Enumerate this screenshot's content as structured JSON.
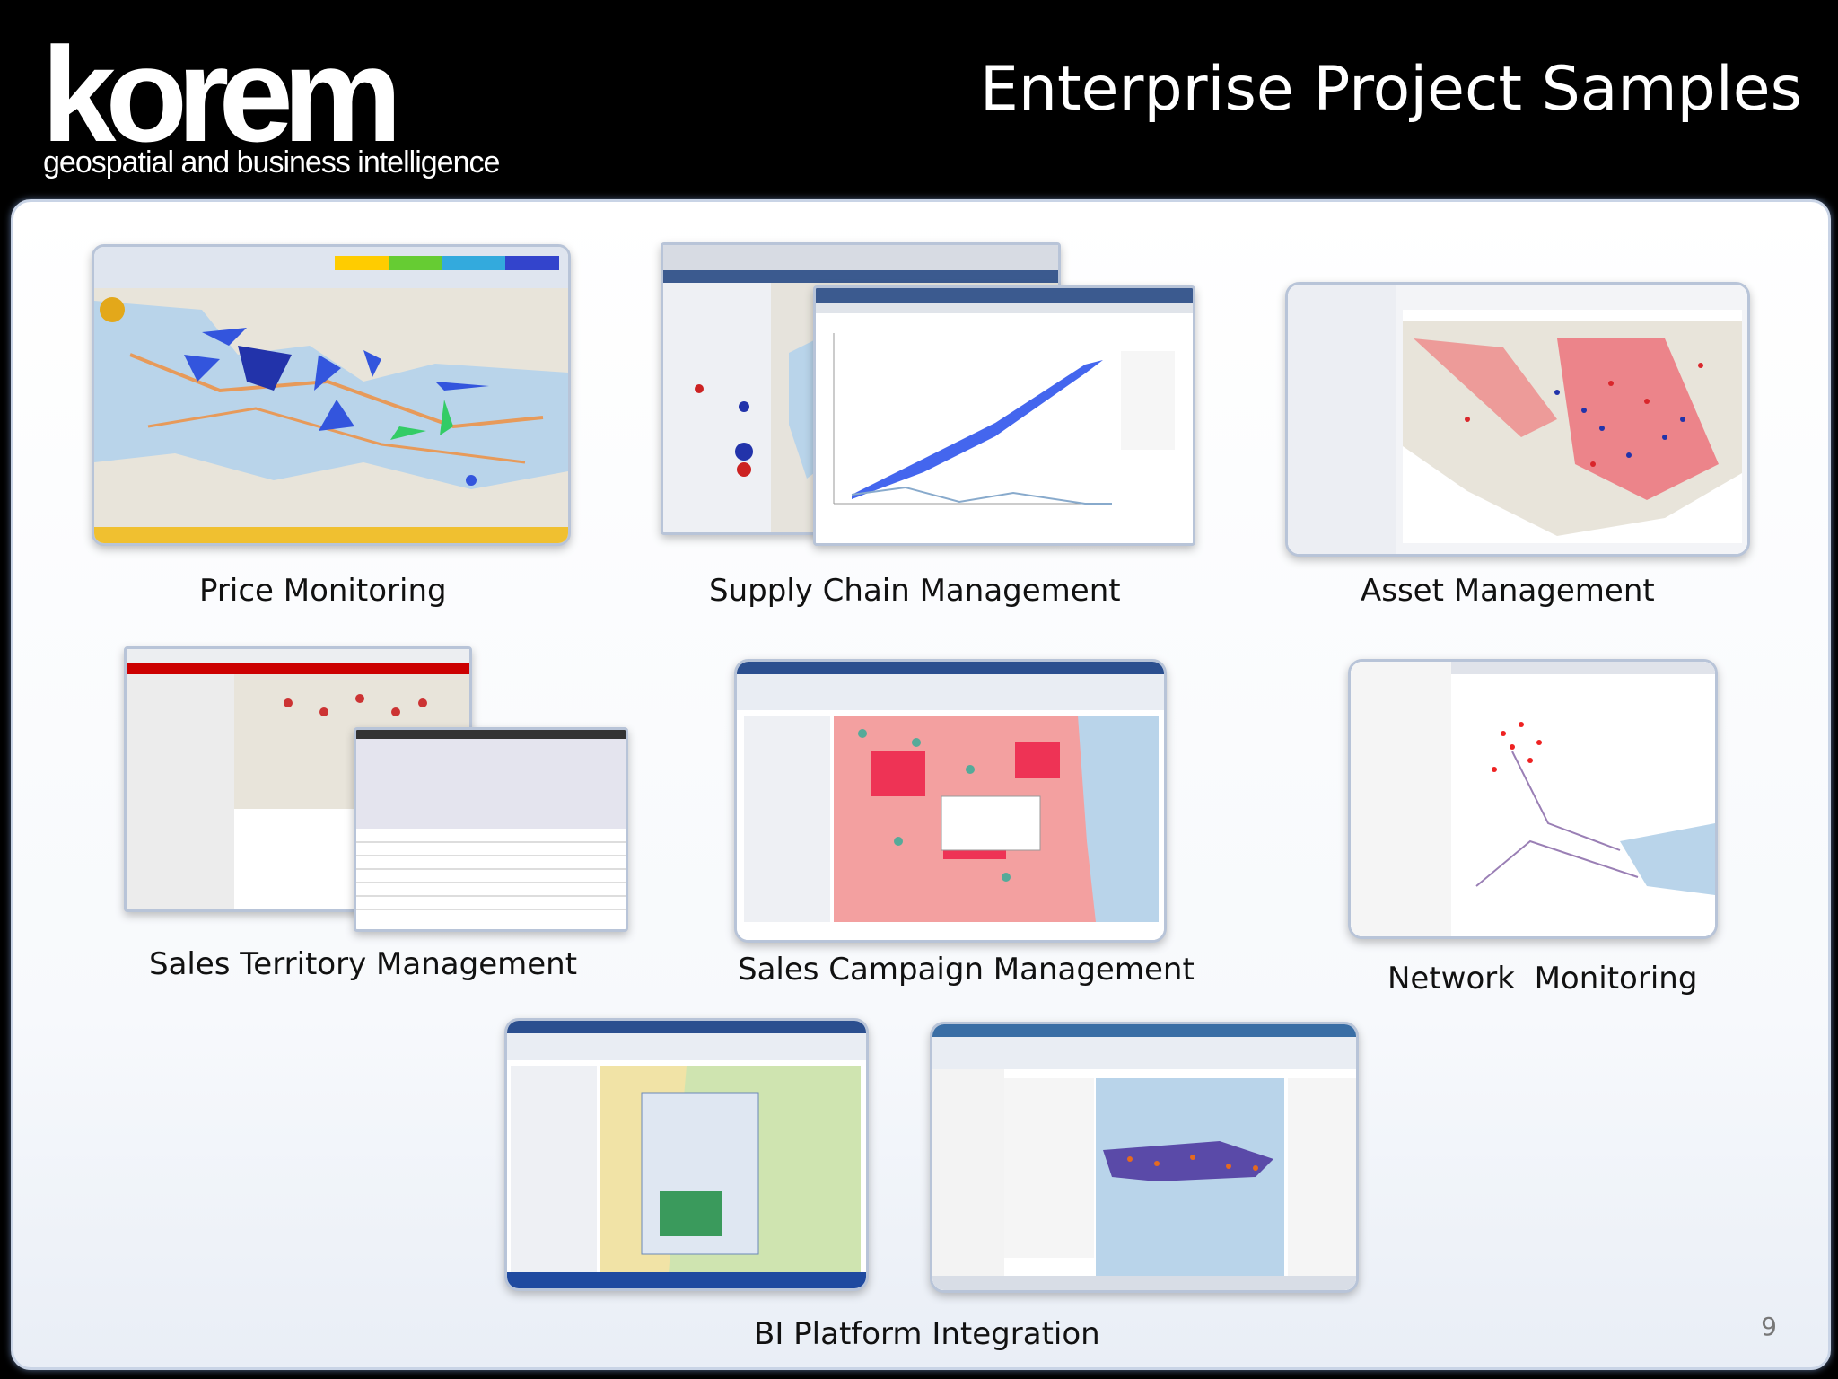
{
  "brand": {
    "name": "korem",
    "tagline": "geospatial and business intelligence"
  },
  "slide": {
    "title": "Enterprise Project Samples",
    "page_number": "9"
  },
  "samples": [
    {
      "caption": "Price Monitoring"
    },
    {
      "caption": "Supply Chain Management"
    },
    {
      "caption": "Asset Management"
    },
    {
      "caption": "Sales Territory Management"
    },
    {
      "caption": "Sales Campaign Management"
    },
    {
      "caption": "Network  Monitoring"
    },
    {
      "caption": "BI Platform Integration"
    }
  ],
  "colors": {
    "header_bg": "#000000",
    "panel_border": "#c9d4e6",
    "map_land": "#e8e4da",
    "map_water": "#b9d4ea",
    "accent_red": "#d9262b",
    "accent_blue": "#3355dd"
  }
}
